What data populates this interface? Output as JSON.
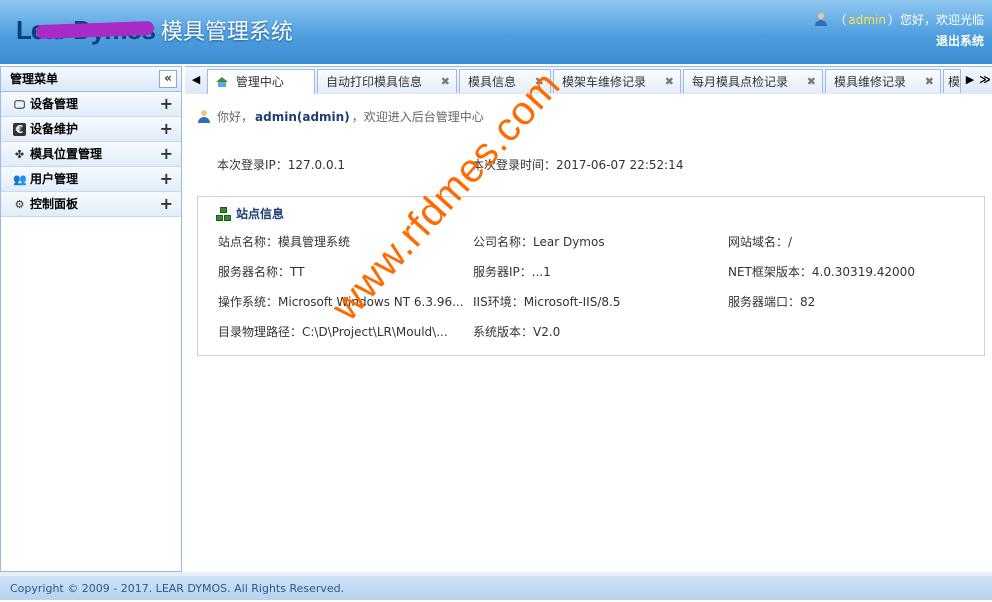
{
  "header": {
    "logo_text": "Lear Dymos",
    "title": "模具管理系统",
    "user_prefix": "（",
    "user_name": "admin",
    "user_suffix": "）您好，欢迎光临",
    "logout_label": "退出系统"
  },
  "sidebar": {
    "title": "管理菜单",
    "collapse_icon": "«",
    "items": [
      {
        "label": "设备管理",
        "icon": "monitor-icon"
      },
      {
        "label": "设备维护",
        "icon": "euro-icon"
      },
      {
        "label": "模具位置管理",
        "icon": "leaf-icon"
      },
      {
        "label": "用户管理",
        "icon": "users-icon"
      },
      {
        "label": "控制面板",
        "icon": "gear-icon"
      }
    ]
  },
  "tabs": [
    {
      "label": "管理中心",
      "active": true
    },
    {
      "label": "自动打印模具信息"
    },
    {
      "label": "模具信息"
    },
    {
      "label": "模架车维修记录"
    },
    {
      "label": "每月模具点检记录"
    },
    {
      "label": "模具维修记录"
    },
    {
      "label": "模"
    }
  ],
  "content": {
    "welcome_prefix": "你好，",
    "welcome_user": "admin(admin)",
    "welcome_suffix": "，欢迎进入后台管理中心",
    "login_ip": "本次登录IP：127.0.0.1",
    "login_time": "本次登录时间：2017-06-07 22:52:14",
    "site_info_title": "站点信息",
    "site_info": {
      "site_name": "站点名称：模具管理系统",
      "company_name": "公司名称：Lear Dymos",
      "domain": "网站域名：/",
      "server_name": "服务器名称：TT",
      "server_ip": "服务器IP：...1",
      "net_version": "NET框架版本：4.0.30319.42000",
      "os": "操作系统：Microsoft Windows NT 6.3.96...",
      "iis": "IIS环境：Microsoft-IIS/8.5",
      "port": "服务器端口：82",
      "path": "目录物理路径：C:\\D\\Project\\LR\\Mould\\...",
      "version": "系统版本：V2.0"
    }
  },
  "footer": {
    "copyright": "Copyright © 2009 - 2017. LEAR DYMOS. All Rights Reserved."
  },
  "watermark": "www.rfdmes.com",
  "colors": {
    "header": "#4f9fdf",
    "accent_text": "#1c3f74",
    "watermark": "#ff6a00"
  }
}
